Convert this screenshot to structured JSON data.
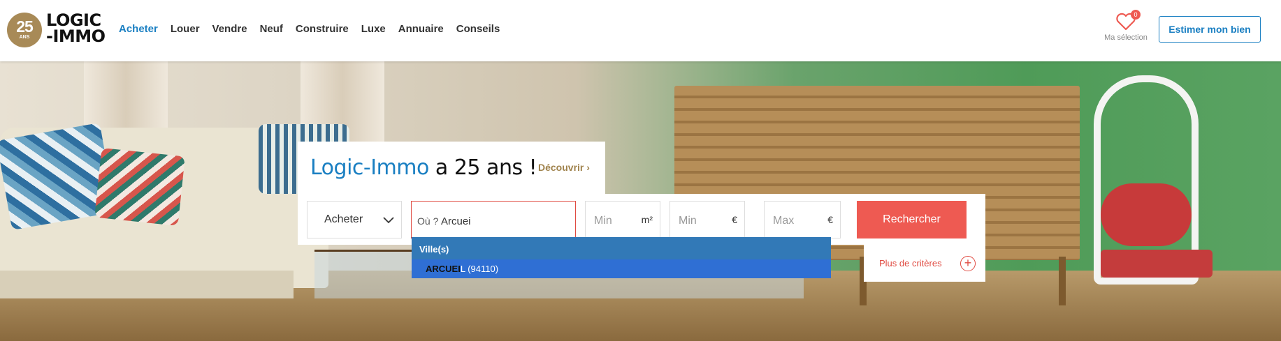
{
  "logo": {
    "badge_number": "25",
    "badge_suffix": "ANS",
    "line1": "LOGIC",
    "line2": "-IMMO"
  },
  "nav": [
    {
      "label": "Acheter",
      "active": true
    },
    {
      "label": "Louer",
      "active": false
    },
    {
      "label": "Vendre",
      "active": false
    },
    {
      "label": "Neuf",
      "active": false
    },
    {
      "label": "Construire",
      "active": false
    },
    {
      "label": "Luxe",
      "active": false
    },
    {
      "label": "Annuaire",
      "active": false
    },
    {
      "label": "Conseils",
      "active": false
    }
  ],
  "favorites": {
    "count": "0",
    "label": "Ma sélection",
    "icon": "heart-icon"
  },
  "estimate_button": "Estimer mon bien",
  "promo": {
    "brand": "Logic-Immo",
    "rest": " a 25 ans !",
    "discover": "Découvrir"
  },
  "search": {
    "transaction": "Acheter",
    "where_label": "Où ?",
    "where_value": "Arcuei",
    "surface_placeholder": "Min",
    "surface_unit": "m²",
    "price_min_placeholder": "Min",
    "price_max_placeholder": "Max",
    "currency": "€",
    "submit": "Rechercher",
    "more_criteria": "Plus de critères"
  },
  "autocomplete": {
    "header": "Ville(s)",
    "items": [
      {
        "match": "ARCUEI",
        "rest": "L (94110)"
      }
    ]
  },
  "colors": {
    "brand_blue": "#1a7fc2",
    "accent_red": "#ee5a52",
    "gold": "#a88a57",
    "dropdown_header": "#3279b7",
    "dropdown_item": "#2f6fd4"
  }
}
